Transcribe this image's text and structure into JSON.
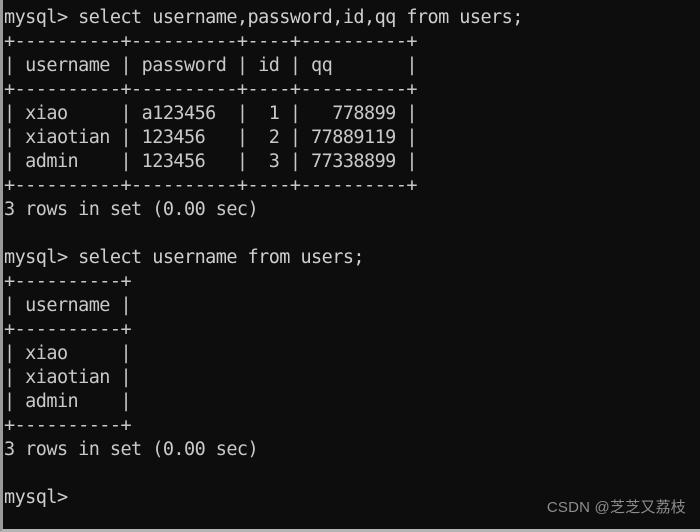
{
  "terminal": {
    "prompt": "mysql>",
    "background_color": "#0d0d0d",
    "text_color": "#c9c9c9",
    "border_color": "#9a9a9a",
    "lines": [
      {
        "kind": "prompt",
        "text": "mysql> select username,password,id,qq from users;"
      },
      {
        "kind": "rule",
        "text": "+----------+----------+----+----------+"
      },
      {
        "kind": "row",
        "text": "| username | password | id | qq       |"
      },
      {
        "kind": "rule",
        "text": "+----------+----------+----+----------+"
      },
      {
        "kind": "row",
        "text": "| xiao     | a123456  |  1 |   778899 |"
      },
      {
        "kind": "row",
        "text": "| xiaotian | 123456   |  2 | 77889119 |"
      },
      {
        "kind": "row",
        "text": "| admin    | 123456   |  3 | 77338899 |"
      },
      {
        "kind": "rule",
        "text": "+----------+----------+----+----------+"
      },
      {
        "kind": "status",
        "text": "3 rows in set (0.00 sec)"
      },
      {
        "kind": "blank",
        "text": " "
      },
      {
        "kind": "prompt",
        "text": "mysql> select username from users;"
      },
      {
        "kind": "rule",
        "text": "+----------+"
      },
      {
        "kind": "row",
        "text": "| username |"
      },
      {
        "kind": "rule",
        "text": "+----------+"
      },
      {
        "kind": "row",
        "text": "| xiao     |"
      },
      {
        "kind": "row",
        "text": "| xiaotian |"
      },
      {
        "kind": "row",
        "text": "| admin    |"
      },
      {
        "kind": "rule",
        "text": "+----------+"
      },
      {
        "kind": "status",
        "text": "3 rows in set (0.00 sec)"
      },
      {
        "kind": "blank",
        "text": " "
      },
      {
        "kind": "prompt",
        "text": "mysql>"
      }
    ]
  },
  "queries": [
    {
      "sql": "select username,password,id,qq from users;",
      "columns": [
        "username",
        "password",
        "id",
        "qq"
      ],
      "rows": [
        [
          "xiao",
          "a123456",
          "1",
          "778899"
        ],
        [
          "xiaotian",
          "123456",
          "2",
          "77889119"
        ],
        [
          "admin",
          "123456",
          "3",
          "77338899"
        ]
      ],
      "status": "3 rows in set (0.00 sec)",
      "row_count": 3,
      "duration": "0.00 sec"
    },
    {
      "sql": "select username from users;",
      "columns": [
        "username"
      ],
      "rows": [
        [
          "xiao"
        ],
        [
          "xiaotian"
        ],
        [
          "admin"
        ]
      ],
      "status": "3 rows in set (0.00 sec)",
      "row_count": 3,
      "duration": "0.00 sec"
    }
  ],
  "watermark": {
    "text": "CSDN @芝芝又荔枝",
    "color": "#8d8d8d"
  }
}
